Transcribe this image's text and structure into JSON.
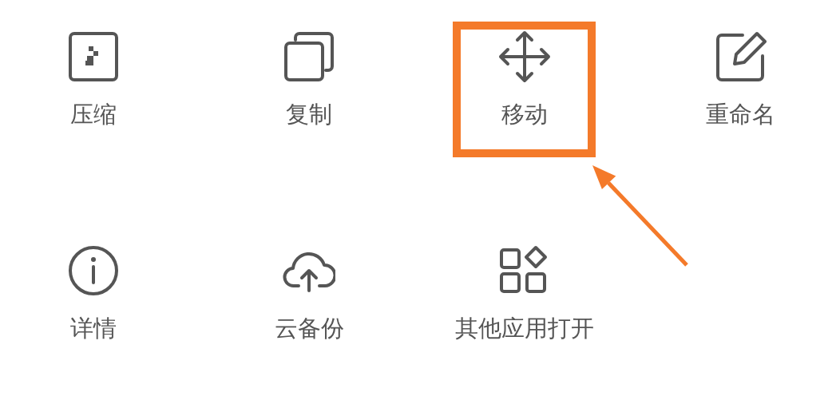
{
  "actions": [
    {
      "label": "压缩",
      "highlighted": false
    },
    {
      "label": "复制",
      "highlighted": false
    },
    {
      "label": "移动",
      "highlighted": true
    },
    {
      "label": "重命名",
      "highlighted": false
    },
    {
      "label": "详情",
      "highlighted": false
    },
    {
      "label": "云备份",
      "highlighted": false
    },
    {
      "label": "其他应用打开",
      "highlighted": false
    }
  ]
}
